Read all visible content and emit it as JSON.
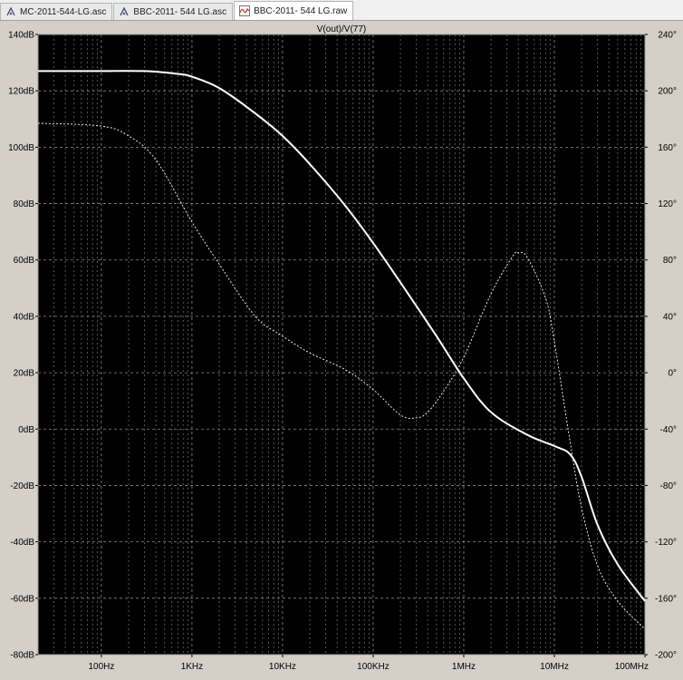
{
  "tabs": [
    {
      "label": "MC-2011-544-LG.asc",
      "icon": "schematic-icon",
      "active": false
    },
    {
      "label": "BBC-2011- 544 LG.asc",
      "icon": "schematic-icon",
      "active": false
    },
    {
      "label": "BBC-2011- 544 LG.raw",
      "icon": "waveform-icon",
      "active": true
    }
  ],
  "plot": {
    "title": "V(out)/V(77)"
  },
  "chart_data": {
    "type": "line",
    "title": "V(out)/V(77)",
    "x_scale": "log",
    "xlim": [
      20,
      100000000
    ],
    "x_ticks": [
      {
        "value": 100,
        "label": "100Hz"
      },
      {
        "value": 1000,
        "label": "1KHz"
      },
      {
        "value": 10000,
        "label": "10KHz"
      },
      {
        "value": 100000,
        "label": "100KHz"
      },
      {
        "value": 1000000,
        "label": "1MHz"
      },
      {
        "value": 10000000,
        "label": "10MHz"
      },
      {
        "value": 100000000,
        "label": "100MHz"
      }
    ],
    "y_left": {
      "ylim": [
        -80,
        140
      ],
      "ticks": [
        {
          "value": 140,
          "label": "140dB"
        },
        {
          "value": 120,
          "label": "120dB"
        },
        {
          "value": 100,
          "label": "100dB"
        },
        {
          "value": 80,
          "label": "80dB"
        },
        {
          "value": 60,
          "label": "60dB"
        },
        {
          "value": 40,
          "label": "40dB"
        },
        {
          "value": 20,
          "label": "20dB"
        },
        {
          "value": 0,
          "label": "0dB"
        },
        {
          "value": -20,
          "label": "-20dB"
        },
        {
          "value": -40,
          "label": "-40dB"
        },
        {
          "value": -60,
          "label": "-60dB"
        },
        {
          "value": -80,
          "label": "-80dB"
        }
      ]
    },
    "y_right": {
      "ylim": [
        -200,
        240
      ],
      "ticks": [
        {
          "value": 240,
          "label": "240°"
        },
        {
          "value": 200,
          "label": "200°"
        },
        {
          "value": 160,
          "label": "160°"
        },
        {
          "value": 120,
          "label": "120°"
        },
        {
          "value": 80,
          "label": "80°"
        },
        {
          "value": 40,
          "label": "40°"
        },
        {
          "value": 0,
          "label": "0°"
        },
        {
          "value": -40,
          "label": "-40°"
        },
        {
          "value": -80,
          "label": "-80°"
        },
        {
          "value": -120,
          "label": "-120°"
        },
        {
          "value": -160,
          "label": "-160°"
        },
        {
          "value": -200,
          "label": "-200°"
        }
      ]
    },
    "grid": true,
    "series": [
      {
        "id": "magnitude",
        "axis": "left",
        "style": "solid",
        "color": "#ffffff",
        "x": [
          20,
          100,
          300,
          700,
          1000,
          2000,
          5000,
          10000,
          20000,
          50000,
          100000,
          200000,
          500000,
          1000000,
          2000000,
          5000000,
          10000000,
          15000000,
          20000000,
          30000000,
          50000000,
          100000000
        ],
        "y": [
          127,
          127,
          127,
          126,
          125,
          121,
          112,
          104,
          94,
          79,
          66,
          52,
          33,
          18,
          6,
          -2,
          -6,
          -9,
          -17,
          -34,
          -48,
          -61
        ]
      },
      {
        "id": "phase",
        "axis": "right",
        "style": "dashed",
        "color": "#ffffff",
        "x": [
          20,
          100,
          200,
          400,
          1000,
          2000,
          5000,
          10000,
          20000,
          50000,
          100000,
          200000,
          300000,
          400000,
          600000,
          1000000,
          2000000,
          3500000,
          4000000,
          5000000,
          8000000,
          10000000,
          15000000,
          20000000,
          30000000,
          50000000,
          100000000
        ],
        "y": [
          177,
          175,
          168,
          151,
          107,
          77,
          40,
          26,
          14,
          2,
          -12,
          -30,
          -32,
          -28,
          -13,
          11,
          56,
          83,
          85,
          82,
          53,
          22,
          -50,
          -96,
          -137,
          -162,
          -182
        ]
      }
    ]
  }
}
